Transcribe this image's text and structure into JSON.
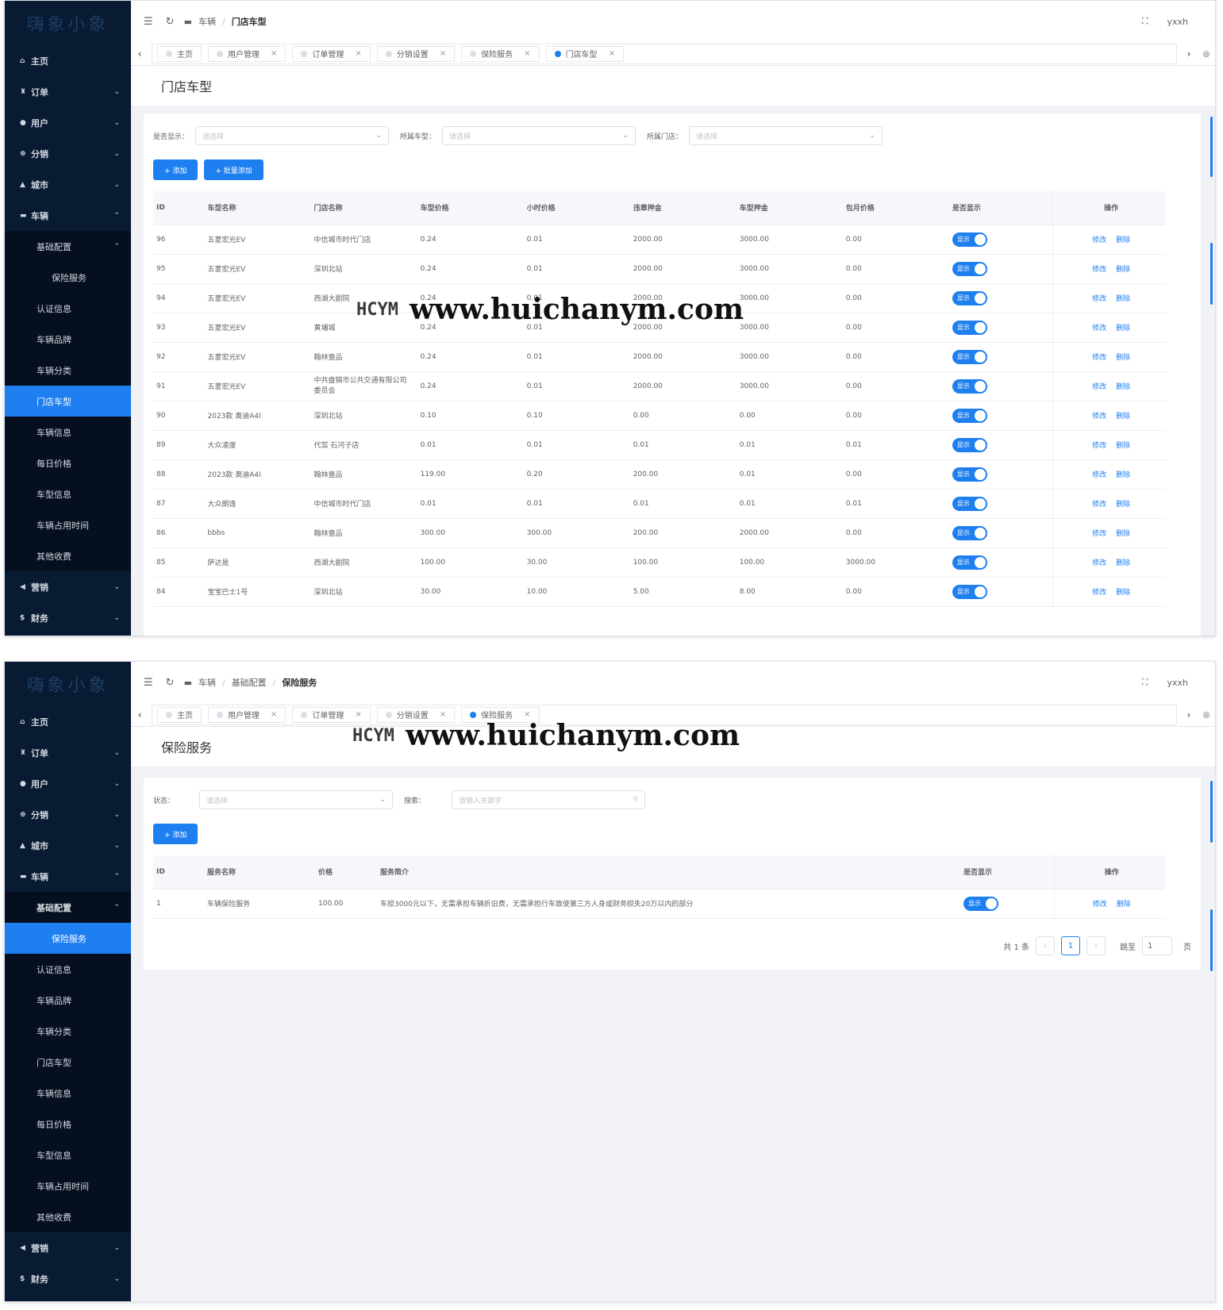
{
  "p1": {
    "logo_text": "嗨象小象",
    "menu": [
      {
        "icon": "home-icon",
        "glyph": "⌂",
        "label": "主页",
        "type": "top"
      },
      {
        "icon": "order-icon",
        "glyph": "♜",
        "label": "订单",
        "type": "top",
        "chev": "⌄"
      },
      {
        "icon": "user-icon",
        "glyph": "●",
        "label": "用户",
        "type": "top",
        "chev": "⌄"
      },
      {
        "icon": "distribution-icon",
        "glyph": "⊕",
        "label": "分销",
        "type": "top",
        "chev": "⌄"
      },
      {
        "icon": "city-icon",
        "glyph": "▲",
        "label": "城市",
        "type": "top",
        "chev": "⌄"
      },
      {
        "icon": "vehicle-icon",
        "glyph": "▬",
        "label": "车辆",
        "type": "top",
        "chev": "⌃"
      },
      {
        "label": "基础配置",
        "type": "sub",
        "chev": "⌃"
      },
      {
        "label": "保险服务",
        "type": "sub2"
      },
      {
        "label": "认证信息",
        "type": "sub"
      },
      {
        "label": "车辆品牌",
        "type": "sub"
      },
      {
        "label": "车辆分类",
        "type": "sub"
      },
      {
        "label": "门店车型",
        "type": "sub",
        "active": true
      },
      {
        "label": "车辆信息",
        "type": "sub"
      },
      {
        "label": "每日价格",
        "type": "sub"
      },
      {
        "label": "车型信息",
        "type": "sub"
      },
      {
        "label": "车辆占用时间",
        "type": "sub"
      },
      {
        "label": "其他收费",
        "type": "sub"
      },
      {
        "icon": "marketing-icon",
        "glyph": "◀",
        "label": "营销",
        "type": "top",
        "chev": "⌄"
      },
      {
        "icon": "finance-icon",
        "glyph": "$",
        "label": "财务",
        "type": "top",
        "chev": "⌄"
      }
    ],
    "breadcrumb": [
      "车辆",
      "门店车型"
    ],
    "user": "yxxh",
    "tabs": [
      {
        "label": "主页",
        "active": false,
        "close": false
      },
      {
        "label": "用户管理",
        "active": false,
        "close": true
      },
      {
        "label": "订单管理",
        "active": false,
        "close": true
      },
      {
        "label": "分销设置",
        "active": false,
        "close": true
      },
      {
        "label": "保险服务",
        "active": false,
        "close": true
      },
      {
        "label": "门店车型",
        "active": true,
        "close": true
      }
    ],
    "page_title": "门店车型",
    "filters": [
      {
        "label": "是否显示：",
        "placeholder": "请选择"
      },
      {
        "label": "所属车型：",
        "placeholder": "请选择"
      },
      {
        "label": "所属门店：",
        "placeholder": "请选择"
      }
    ],
    "buttons": [
      "+ 添加",
      "+ 批量添加"
    ],
    "columns": [
      "ID",
      "车型名称",
      "门店名称",
      "车型价格",
      "小时价格",
      "违章押金",
      "车型押金",
      "包月价格",
      "是否显示",
      "操作"
    ],
    "switch_label": "显示",
    "edit_label": "修改",
    "delete_label": "删除",
    "rows": [
      [
        "96",
        "五菱宏光EV",
        "中信城市时代门店",
        "0.24",
        "0.01",
        "2000.00",
        "3000.00",
        "0.00"
      ],
      [
        "95",
        "五菱宏光EV",
        "深圳北站",
        "0.24",
        "0.01",
        "2000.00",
        "3000.00",
        "0.00"
      ],
      [
        "94",
        "五菱宏光EV",
        "西湖大剧院",
        "0.24",
        "0.01",
        "2000.00",
        "3000.00",
        "0.00"
      ],
      [
        "93",
        "五菱宏光EV",
        "黄埔城",
        "0.24",
        "0.01",
        "2000.00",
        "3000.00",
        "0.00"
      ],
      [
        "92",
        "五菱宏光EV",
        "翰林壹品",
        "0.24",
        "0.01",
        "2000.00",
        "3000.00",
        "0.00"
      ],
      [
        "91",
        "五菱宏光EV",
        "中共盘锦市公共交通有限公司委员会",
        "0.24",
        "0.01",
        "2000.00",
        "3000.00",
        "0.00"
      ],
      [
        "90",
        "2023款 奥迪A4l",
        "深圳北站",
        "0.10",
        "0.10",
        "0.00",
        "0.00",
        "0.00"
      ],
      [
        "89",
        "大众凌度",
        "代驾 石河子店",
        "0.01",
        "0.01",
        "0.01",
        "0.01",
        "0.01"
      ],
      [
        "88",
        "2023款 奥迪A4l",
        "翰林壹品",
        "119.00",
        "0.20",
        "200.00",
        "0.01",
        "0.00"
      ],
      [
        "87",
        "大众朗逸",
        "中信城市时代门店",
        "0.01",
        "0.01",
        "0.01",
        "0.01",
        "0.01"
      ],
      [
        "86",
        "bbbs",
        "翰林壹品",
        "300.00",
        "300.00",
        "200.00",
        "2000.00",
        "0.00"
      ],
      [
        "85",
        "萨达是",
        "西湖大剧院",
        "100.00",
        "30.00",
        "100.00",
        "100.00",
        "3000.00"
      ],
      [
        "84",
        "宝宝巴士1号",
        "深圳北站",
        "30.00",
        "10.00",
        "5.00",
        "8.00",
        "0.00"
      ]
    ]
  },
  "p2": {
    "logo_text": "嗨象小象",
    "menu": [
      {
        "icon": "home-icon",
        "glyph": "⌂",
        "label": "主页",
        "type": "top"
      },
      {
        "icon": "order-icon",
        "glyph": "♜",
        "label": "订单",
        "type": "top",
        "chev": "⌄"
      },
      {
        "icon": "user-icon",
        "glyph": "●",
        "label": "用户",
        "type": "top",
        "chev": "⌄"
      },
      {
        "icon": "distribution-icon",
        "glyph": "⊕",
        "label": "分销",
        "type": "top",
        "chev": "⌄"
      },
      {
        "icon": "city-icon",
        "glyph": "▲",
        "label": "城市",
        "type": "top",
        "chev": "⌄"
      },
      {
        "icon": "vehicle-icon",
        "glyph": "▬",
        "label": "车辆",
        "type": "top",
        "chev": "⌃"
      },
      {
        "label": "基础配置",
        "type": "sub",
        "chev": "⌃",
        "bold": true
      },
      {
        "label": "保险服务",
        "type": "sub2",
        "active": true
      },
      {
        "label": "认证信息",
        "type": "sub"
      },
      {
        "label": "车辆品牌",
        "type": "sub"
      },
      {
        "label": "车辆分类",
        "type": "sub"
      },
      {
        "label": "门店车型",
        "type": "sub"
      },
      {
        "label": "车辆信息",
        "type": "sub"
      },
      {
        "label": "每日价格",
        "type": "sub"
      },
      {
        "label": "车型信息",
        "type": "sub"
      },
      {
        "label": "车辆占用时间",
        "type": "sub"
      },
      {
        "label": "其他收费",
        "type": "sub"
      },
      {
        "icon": "marketing-icon",
        "glyph": "◀",
        "label": "营销",
        "type": "top",
        "chev": "⌄"
      },
      {
        "icon": "finance-icon",
        "glyph": "$",
        "label": "财务",
        "type": "top",
        "chev": "⌄"
      }
    ],
    "breadcrumb": [
      "车辆",
      "基础配置",
      "保险服务"
    ],
    "user": "yxxh",
    "tabs": [
      {
        "label": "主页",
        "active": false,
        "close": false
      },
      {
        "label": "用户管理",
        "active": false,
        "close": true
      },
      {
        "label": "订单管理",
        "active": false,
        "close": true
      },
      {
        "label": "分销设置",
        "active": false,
        "close": true
      },
      {
        "label": "保险服务",
        "active": true,
        "close": true
      }
    ],
    "page_title": "保险服务",
    "filter_status": {
      "label": "状态：",
      "placeholder": "请选择"
    },
    "filter_search": {
      "label": "搜索：",
      "placeholder": "请输入关键字"
    },
    "add_button": "+ 添加",
    "columns": [
      "ID",
      "服务名称",
      "价格",
      "服务简介",
      "是否显示",
      "操作"
    ],
    "switch_label": "显示",
    "edit_label": "修改",
    "delete_label": "删除",
    "rows": [
      [
        "1",
        "车辆保险服务",
        "100.00",
        "车损3000元以下，无需承担车辆折旧费，无需承担行车致使第三方人身或财务损失20万以内的部分"
      ]
    ],
    "pager": {
      "total": "共 1 条",
      "prev": "‹",
      "page": "1",
      "next": "›",
      "jump_label": "跳至",
      "jump_value": "1",
      "page_unit": "页"
    }
  },
  "watermark": {
    "logo": "HCYM",
    "url": "www.huichanym.com"
  },
  "colors": {
    "sidebar": "#081b33",
    "accent": "#1e7ff0"
  }
}
